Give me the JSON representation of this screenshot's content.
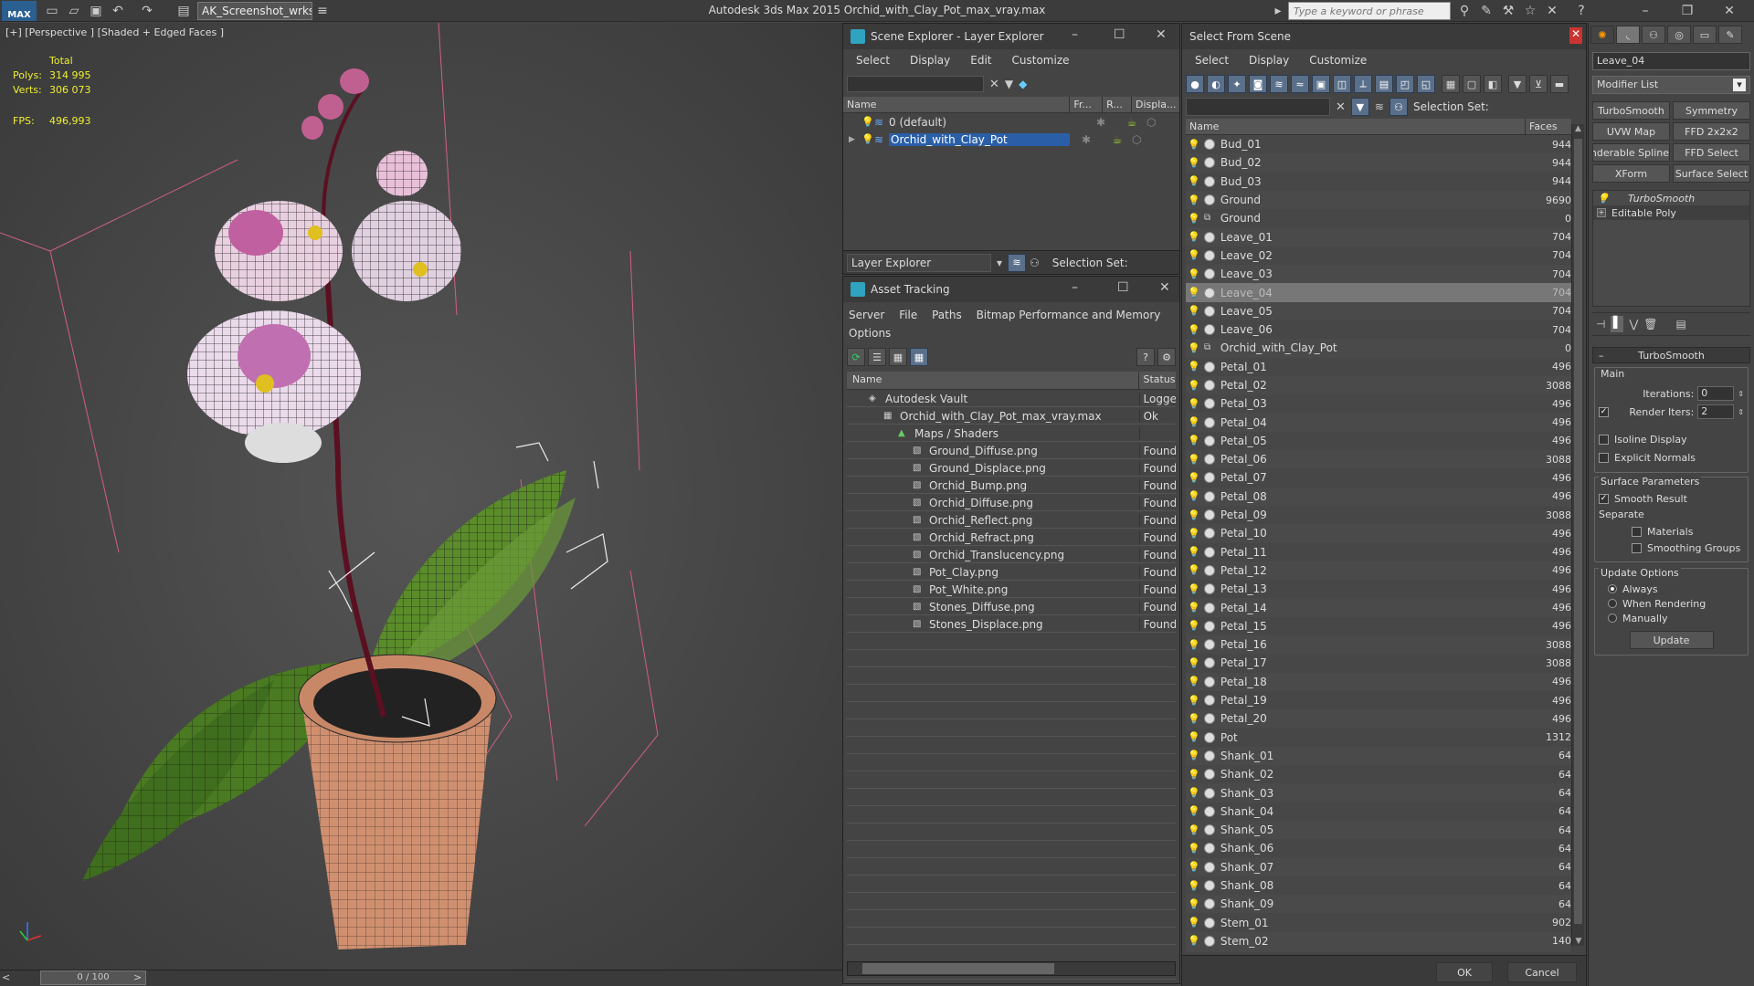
{
  "app": {
    "logo": "MAX",
    "workspace": "AK_Screenshot_wrksp",
    "title": "Autodesk 3ds Max  2015    Orchid_with_Clay_Pot_max_vray.max",
    "search_placeholder": "Type a keyword or phrase"
  },
  "viewport": {
    "label": "[+] [Perspective ] [Shaded + Edged Faces ]",
    "stats_total": "Total",
    "polys_label": "Polys:",
    "polys_value": "314 995",
    "verts_label": "Verts:",
    "verts_value": "306 073",
    "fps_label": "FPS:",
    "fps_value": "496,993",
    "time": "0 / 100"
  },
  "scene_explorer": {
    "title": "Scene Explorer - Layer Explorer",
    "menu": [
      "Select",
      "Display",
      "Edit",
      "Customize"
    ],
    "columns": [
      "Name",
      "Fr...",
      "R...",
      "Displa..."
    ],
    "rows": [
      {
        "name": "0 (default)",
        "selected": false
      },
      {
        "name": "Orchid_with_Clay_Pot",
        "selected": true
      }
    ],
    "footer_dropdown": "Layer Explorer",
    "selection_set": "Selection Set:"
  },
  "asset_tracking": {
    "title": "Asset Tracking",
    "menu": [
      "Server",
      "File",
      "Paths",
      "Bitmap Performance and Memory"
    ],
    "menu2": "Options",
    "columns": [
      "Name",
      "Status"
    ],
    "rows": [
      {
        "name": "Autodesk Vault",
        "status": "Logge",
        "indent": 1
      },
      {
        "name": "Orchid_with_Clay_Pot_max_vray.max",
        "status": "Ok",
        "indent": 2
      },
      {
        "name": "Maps / Shaders",
        "status": "",
        "indent": 3
      },
      {
        "name": "Ground_Diffuse.png",
        "status": "Found",
        "indent": 4
      },
      {
        "name": "Ground_Displace.png",
        "status": "Found",
        "indent": 4
      },
      {
        "name": "Orchid_Bump.png",
        "status": "Found",
        "indent": 4
      },
      {
        "name": "Orchid_Diffuse.png",
        "status": "Found",
        "indent": 4
      },
      {
        "name": "Orchid_Reflect.png",
        "status": "Found",
        "indent": 4
      },
      {
        "name": "Orchid_Refract.png",
        "status": "Found",
        "indent": 4
      },
      {
        "name": "Orchid_Translucency.png",
        "status": "Found",
        "indent": 4
      },
      {
        "name": "Pot_Clay.png",
        "status": "Found",
        "indent": 4
      },
      {
        "name": "Pot_White.png",
        "status": "Found",
        "indent": 4
      },
      {
        "name": "Stones_Diffuse.png",
        "status": "Found",
        "indent": 4
      },
      {
        "name": "Stones_Displace.png",
        "status": "Found",
        "indent": 4
      }
    ]
  },
  "select_from_scene": {
    "title": "Select From Scene",
    "menu": [
      "Select",
      "Display",
      "Customize"
    ],
    "selection_set": "Selection Set:",
    "columns": [
      "Name",
      "Faces"
    ],
    "rows": [
      {
        "name": "Bud_01",
        "faces": "944",
        "icon": "sphere"
      },
      {
        "name": "Bud_02",
        "faces": "944",
        "icon": "sphere"
      },
      {
        "name": "Bud_03",
        "faces": "944",
        "icon": "sphere"
      },
      {
        "name": "Ground",
        "faces": "9690",
        "icon": "sphere"
      },
      {
        "name": "Ground",
        "faces": "0",
        "icon": "group"
      },
      {
        "name": "Leave_01",
        "faces": "704",
        "icon": "sphere"
      },
      {
        "name": "Leave_02",
        "faces": "704",
        "icon": "sphere"
      },
      {
        "name": "Leave_03",
        "faces": "704",
        "icon": "sphere"
      },
      {
        "name": "Leave_04",
        "faces": "704",
        "icon": "sphere",
        "selected": true
      },
      {
        "name": "Leave_05",
        "faces": "704",
        "icon": "sphere"
      },
      {
        "name": "Leave_06",
        "faces": "704",
        "icon": "sphere"
      },
      {
        "name": "Orchid_with_Clay_Pot",
        "faces": "0",
        "icon": "group"
      },
      {
        "name": "Petal_01",
        "faces": "496",
        "icon": "sphere"
      },
      {
        "name": "Petal_02",
        "faces": "3088",
        "icon": "sphere"
      },
      {
        "name": "Petal_03",
        "faces": "496",
        "icon": "sphere"
      },
      {
        "name": "Petal_04",
        "faces": "496",
        "icon": "sphere"
      },
      {
        "name": "Petal_05",
        "faces": "496",
        "icon": "sphere"
      },
      {
        "name": "Petal_06",
        "faces": "3088",
        "icon": "sphere"
      },
      {
        "name": "Petal_07",
        "faces": "496",
        "icon": "sphere"
      },
      {
        "name": "Petal_08",
        "faces": "496",
        "icon": "sphere"
      },
      {
        "name": "Petal_09",
        "faces": "3088",
        "icon": "sphere"
      },
      {
        "name": "Petal_10",
        "faces": "496",
        "icon": "sphere"
      },
      {
        "name": "Petal_11",
        "faces": "496",
        "icon": "sphere"
      },
      {
        "name": "Petal_12",
        "faces": "496",
        "icon": "sphere"
      },
      {
        "name": "Petal_13",
        "faces": "496",
        "icon": "sphere"
      },
      {
        "name": "Petal_14",
        "faces": "496",
        "icon": "sphere"
      },
      {
        "name": "Petal_15",
        "faces": "496",
        "icon": "sphere"
      },
      {
        "name": "Petal_16",
        "faces": "3088",
        "icon": "sphere"
      },
      {
        "name": "Petal_17",
        "faces": "3088",
        "icon": "sphere"
      },
      {
        "name": "Petal_18",
        "faces": "496",
        "icon": "sphere"
      },
      {
        "name": "Petal_19",
        "faces": "496",
        "icon": "sphere"
      },
      {
        "name": "Petal_20",
        "faces": "496",
        "icon": "sphere"
      },
      {
        "name": "Pot",
        "faces": "1312",
        "icon": "sphere"
      },
      {
        "name": "Shank_01",
        "faces": "64",
        "icon": "sphere"
      },
      {
        "name": "Shank_02",
        "faces": "64",
        "icon": "sphere"
      },
      {
        "name": "Shank_03",
        "faces": "64",
        "icon": "sphere"
      },
      {
        "name": "Shank_04",
        "faces": "64",
        "icon": "sphere"
      },
      {
        "name": "Shank_05",
        "faces": "64",
        "icon": "sphere"
      },
      {
        "name": "Shank_06",
        "faces": "64",
        "icon": "sphere"
      },
      {
        "name": "Shank_07",
        "faces": "64",
        "icon": "sphere"
      },
      {
        "name": "Shank_08",
        "faces": "64",
        "icon": "sphere"
      },
      {
        "name": "Shank_09",
        "faces": "64",
        "icon": "sphere"
      },
      {
        "name": "Stem_01",
        "faces": "902",
        "icon": "sphere"
      },
      {
        "name": "Stem_02",
        "faces": "140",
        "icon": "sphere"
      }
    ],
    "ok": "OK",
    "cancel": "Cancel"
  },
  "command_panel": {
    "object_name": "Leave_04",
    "modifier_list": "Modifier List",
    "buttons": [
      "TurboSmooth",
      "Symmetry",
      "UVW Map",
      "FFD 2x2x2",
      "Renderable Spline",
      "FFD Select",
      "XForm",
      "Surface Select"
    ],
    "stack": [
      "TurboSmooth",
      "Editable Poly"
    ],
    "rollout_title": "TurboSmooth",
    "main_label": "Main",
    "iterations_label": "Iterations:",
    "iterations_value": "0",
    "render_iters_label": "Render Iters:",
    "render_iters_value": "2",
    "isoline_label": "Isoline Display",
    "explicit_label": "Explicit Normals",
    "surface_label": "Surface Parameters",
    "smooth_result_label": "Smooth Result",
    "separate_label": "Separate",
    "materials_label": "Materials",
    "smoothing_groups_label": "Smoothing Groups",
    "update_options_label": "Update Options",
    "always_label": "Always",
    "when_rendering_label": "When Rendering",
    "manually_label": "Manually",
    "update_button": "Update"
  },
  "colors": {
    "accent": "#2a5fa8",
    "yellow": "#eeee33",
    "highlight": "#777777"
  }
}
